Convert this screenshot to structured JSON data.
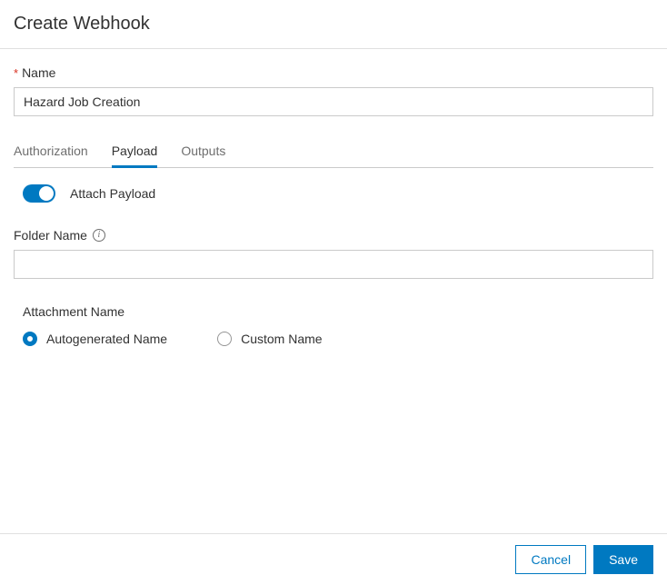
{
  "header": {
    "title": "Create Webhook"
  },
  "form": {
    "name_label": "Name",
    "name_value": "Hazard Job Creation"
  },
  "tabs": {
    "items": [
      {
        "label": "Authorization",
        "active": false
      },
      {
        "label": "Payload",
        "active": true
      },
      {
        "label": "Outputs",
        "active": false
      }
    ]
  },
  "payload": {
    "attach_toggle_label": "Attach Payload",
    "attach_toggle_on": true,
    "folder_name_label": "Folder Name",
    "folder_name_value": "",
    "attachment_name_label": "Attachment Name",
    "radios": {
      "autogenerated": "Autogenerated Name",
      "custom": "Custom Name",
      "selected": "autogenerated"
    }
  },
  "footer": {
    "cancel": "Cancel",
    "save": "Save"
  }
}
